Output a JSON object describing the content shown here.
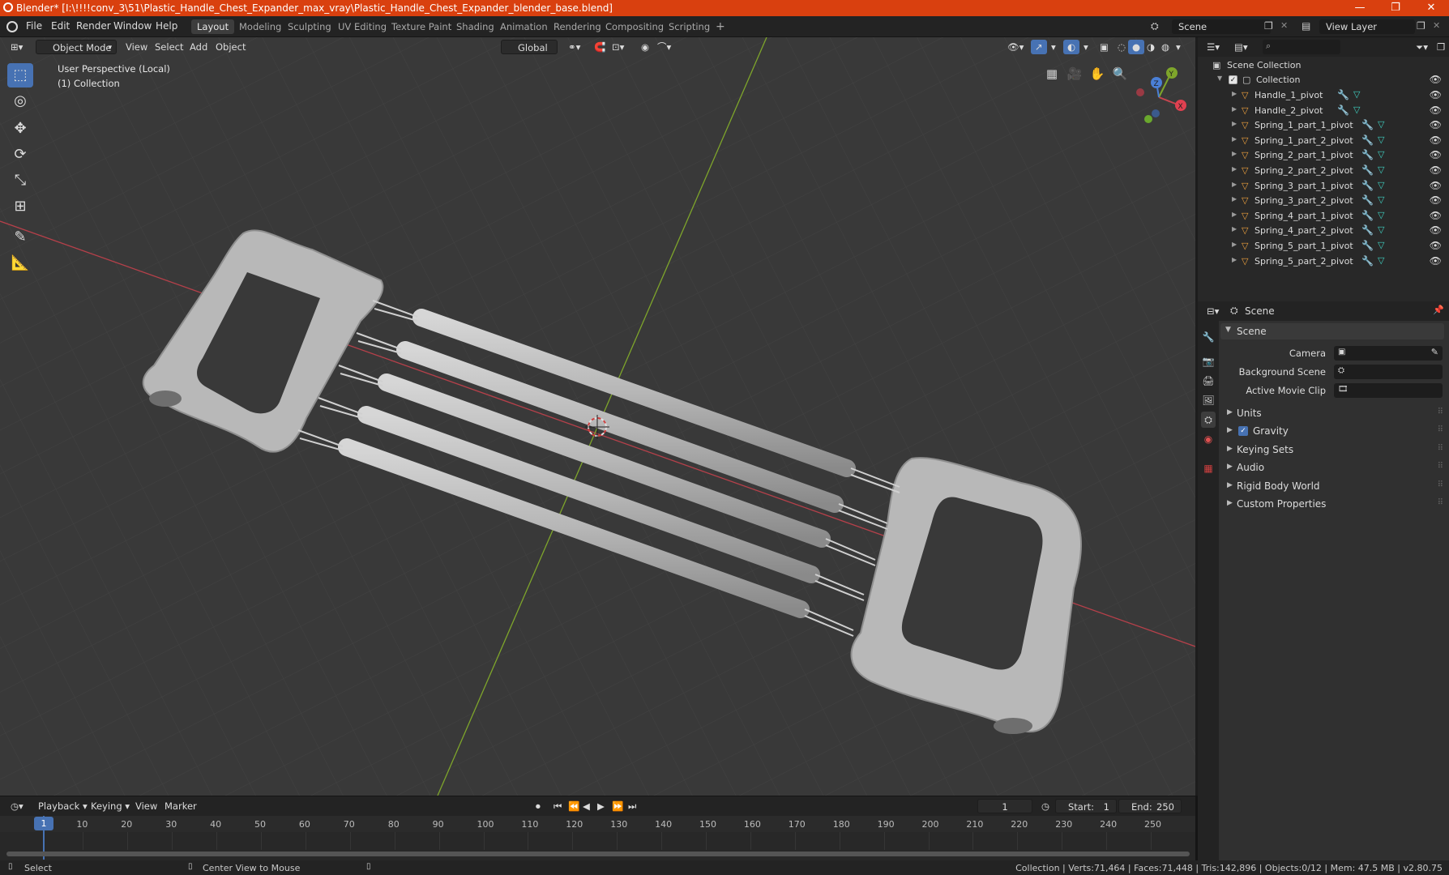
{
  "titlebar": {
    "title": "Blender* [I:\\!!!!conv_3\\51\\Plastic_Handle_Chest_Expander_max_vray\\Plastic_Handle_Chest_Expander_blender_base.blend]",
    "minimize": "—",
    "maximize": "❐",
    "close": "✕"
  },
  "menu": {
    "items": [
      "File",
      "Edit",
      "Render",
      "Window",
      "Help"
    ],
    "workspaces": [
      "Layout",
      "Modeling",
      "Sculpting",
      "UV Editing",
      "Texture Paint",
      "Shading",
      "Animation",
      "Rendering",
      "Compositing",
      "Scripting"
    ],
    "add_workspace": "+",
    "scene_name": "Scene",
    "view_layer": "View Layer"
  },
  "viewport_header": {
    "mode": "Object Mode",
    "menus": [
      "View",
      "Select",
      "Add",
      "Object"
    ],
    "transform_orientation": "Global"
  },
  "viewport": {
    "perspective_label": "User Perspective (Local)",
    "collection_label": "(1) Collection",
    "gizmo_axes": {
      "x": "X",
      "y": "Y",
      "z": "Z"
    }
  },
  "outliner": {
    "root": "Scene Collection",
    "collection": "Collection",
    "objects": [
      "Handle_1_pivot",
      "Handle_2_pivot",
      "Spring_1_part_1_pivot",
      "Spring_1_part_2_pivot",
      "Spring_2_part_1_pivot",
      "Spring_2_part_2_pivot",
      "Spring_3_part_1_pivot",
      "Spring_3_part_2_pivot",
      "Spring_4_part_1_pivot",
      "Spring_4_part_2_pivot",
      "Spring_5_part_1_pivot",
      "Spring_5_part_2_pivot"
    ]
  },
  "properties": {
    "header": "Scene",
    "panel": "Scene",
    "camera_label": "Camera",
    "background_scene_label": "Background Scene",
    "active_movie_clip_label": "Active Movie Clip",
    "subpanels": [
      "Units",
      "Gravity",
      "Keying Sets",
      "Audio",
      "Rigid Body World",
      "Custom Properties"
    ],
    "gravity_checked": true
  },
  "timeline": {
    "menus": [
      "Playback",
      "Keying",
      "View",
      "Marker"
    ],
    "current_frame": "1",
    "start_label": "Start:",
    "start": "1",
    "end_label": "End:",
    "end": "250",
    "ticks": [
      "1",
      "10",
      "20",
      "30",
      "40",
      "50",
      "60",
      "70",
      "80",
      "90",
      "100",
      "110",
      "120",
      "130",
      "140",
      "150",
      "160",
      "170",
      "180",
      "190",
      "200",
      "210",
      "220",
      "230",
      "240",
      "250"
    ]
  },
  "statusbar": {
    "select": "Select",
    "center_view": "Center View to Mouse",
    "stats": "Collection | Verts:71,464 | Faces:71,448 | Tris:142,896 | Objects:0/12 | Mem: 47.5 MB | v2.80.75"
  },
  "colors": {
    "accent": "#4772b3",
    "titlebar": "#d9400f",
    "object_icon": "#f0a23e",
    "x_axis": "#c8454f",
    "y_axis": "#7ea52b"
  }
}
